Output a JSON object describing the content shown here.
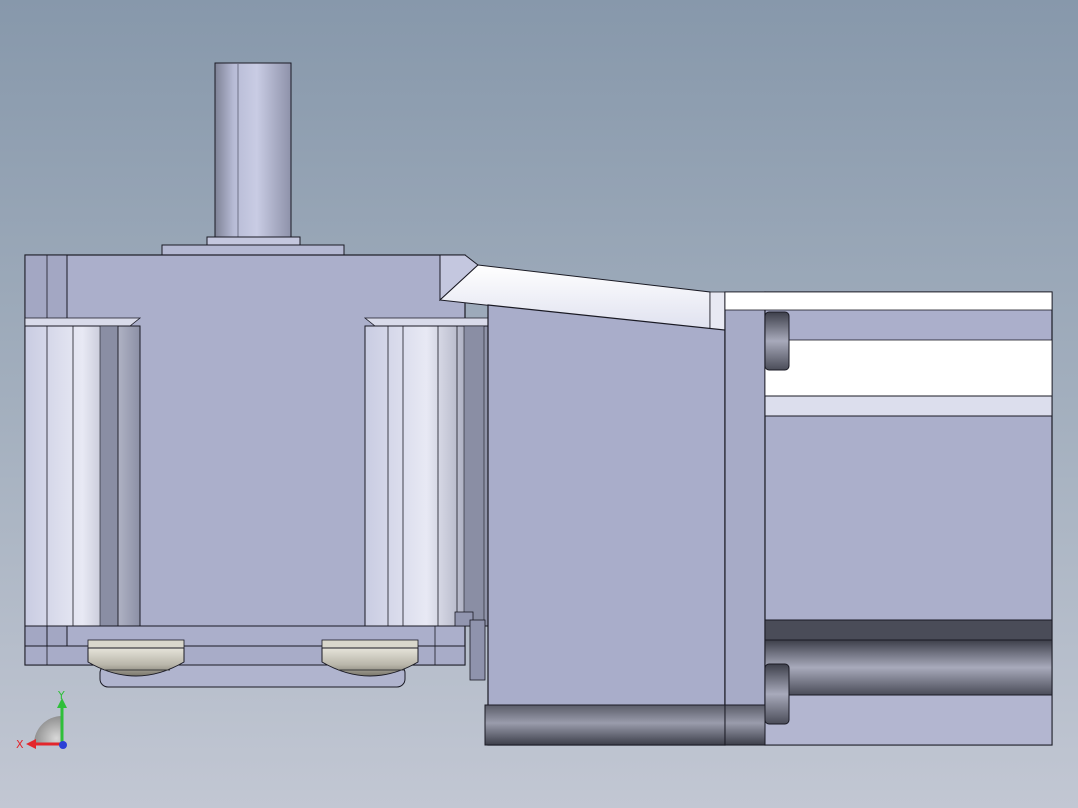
{
  "viewport": {
    "background_top": "#8798ab",
    "background_bottom": "#c2c7d3"
  },
  "model": {
    "body_color": "#abafcb",
    "edge_color": "#1a1a24",
    "highlight_color": "#ffffff",
    "shadow_color": "#3a3c48"
  },
  "triad": {
    "x_label": "X",
    "y_label": "Y",
    "x_color": "#e3262c",
    "y_color": "#2fbf3a",
    "z_color": "#2b3fd6"
  }
}
